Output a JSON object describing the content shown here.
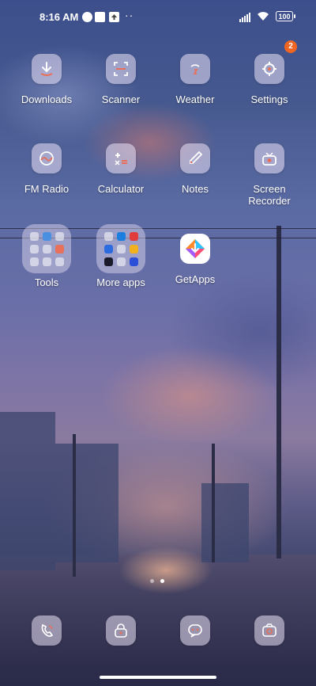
{
  "status_bar": {
    "time": "8:16 AM",
    "battery": "100"
  },
  "notification_badge": "2",
  "apps": {
    "downloads": "Downloads",
    "scanner": "Scanner",
    "weather": "Weather",
    "settings": "Settings",
    "fm_radio": "FM Radio",
    "calculator": "Calculator",
    "notes": "Notes",
    "screen_recorder_1": "Screen",
    "screen_recorder_2": "Recorder",
    "tools": "Tools",
    "more_apps": "More apps",
    "getapps": "GetApps"
  },
  "dock": [
    "phone-icon",
    "security-icon",
    "messages-icon",
    "camera-icon"
  ],
  "pager": {
    "pages": 2,
    "active": 2
  },
  "colors": {
    "badge": "#f06522",
    "icon_accent": "#e8705a"
  }
}
